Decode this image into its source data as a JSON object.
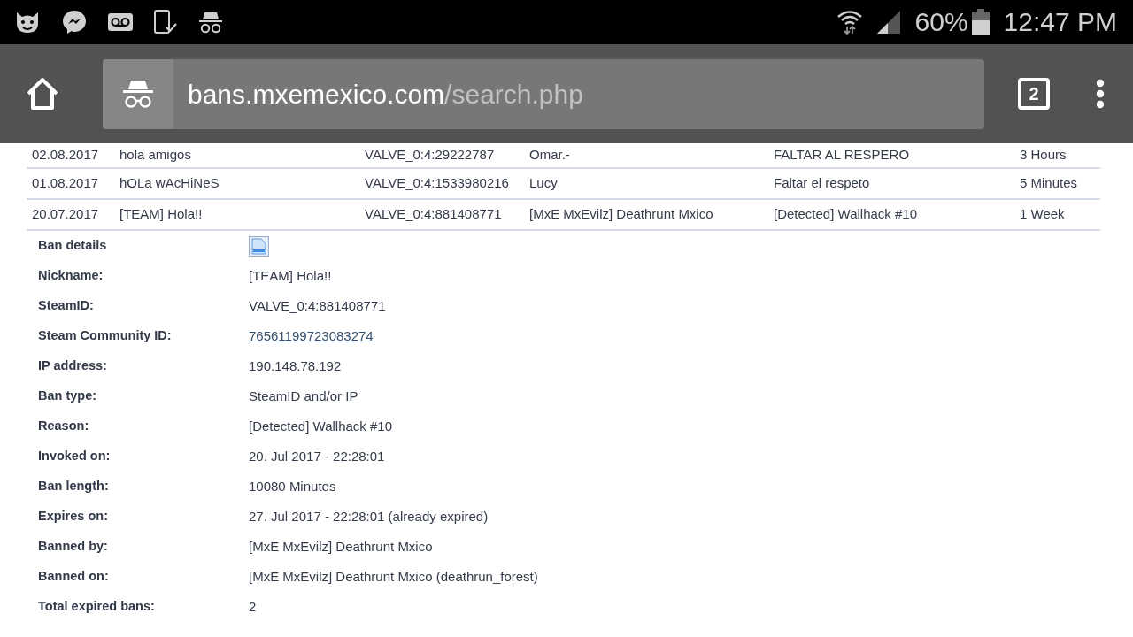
{
  "status_bar": {
    "battery": "60%",
    "time": "12:47 PM"
  },
  "toolbar": {
    "domain": "bans.mxemexico.com",
    "path": "/search.php",
    "tab_count": "2"
  },
  "bans_table": {
    "rows": [
      {
        "cells": [
          "02.08.2017",
          "hola amigos",
          "VALVE_0:4:29222787",
          "Omar.-",
          "FALTAR AL RESPERO",
          "3 Hours"
        ]
      },
      {
        "cells": [
          "01.08.2017",
          "hOLa wAcHiNeS",
          "VALVE_0:4:1533980216",
          "Lucy",
          "Faltar el respeto",
          "5 Minutes"
        ]
      },
      {
        "cells": [
          "20.07.2017",
          "[TEAM] Hola!!",
          "VALVE_0:4:881408771",
          "[MxE MxEvilz] Deathrunt Mxico",
          "[Detected] Wallhack #10",
          "1 Week"
        ]
      }
    ]
  },
  "ban_details": {
    "title": "Ban details",
    "fields": [
      {
        "label": "Nickname:",
        "value": "[TEAM] Hola!!",
        "kind": "text"
      },
      {
        "label": "SteamID:",
        "value": "VALVE_0:4:881408771",
        "kind": "text"
      },
      {
        "label": "Steam Community ID:",
        "value": "76561199723083274",
        "kind": "link"
      },
      {
        "label": "IP address:",
        "value": "190.148.78.192",
        "kind": "text"
      },
      {
        "label": "Ban type:",
        "value": "SteamID and/or IP",
        "kind": "text"
      },
      {
        "label": "Reason:",
        "value": "[Detected] Wallhack #10",
        "kind": "text"
      },
      {
        "label": "Invoked on:",
        "value": "20. Jul 2017 - 22:28:01",
        "kind": "text"
      },
      {
        "label": "Ban length:",
        "value": "10080 Minutes",
        "kind": "text"
      },
      {
        "label": "Expires on:",
        "value": "27. Jul 2017 - 22:28:01 (already expired)",
        "kind": "text"
      },
      {
        "label": "Banned by:",
        "value": "[MxE MxEvilz] Deathrunt Mxico",
        "kind": "text"
      },
      {
        "label": "Banned on:",
        "value": "[MxE MxEvilz] Deathrunt Mxico (deathrun_forest)",
        "kind": "text"
      },
      {
        "label": "Total expired bans:",
        "value": "2",
        "kind": "text"
      }
    ]
  }
}
